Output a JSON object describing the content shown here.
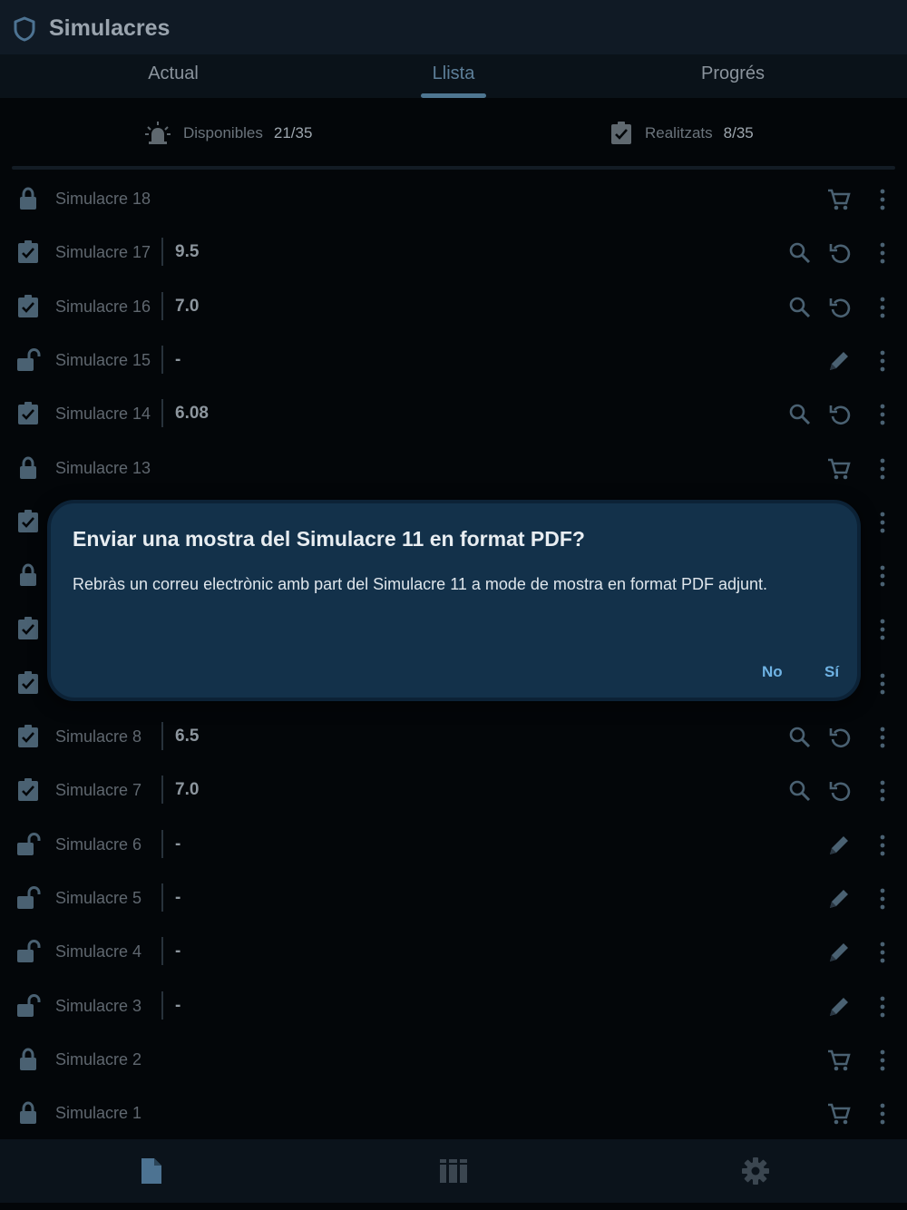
{
  "app": {
    "title": "Simulacres",
    "icon": "shield-icon"
  },
  "tabs": [
    {
      "label": "Actual",
      "active": false
    },
    {
      "label": "Llista",
      "active": true
    },
    {
      "label": "Progrés",
      "active": false
    }
  ],
  "stats": {
    "available": {
      "label": "Disponibles",
      "value": "21/35",
      "icon": "alarm-light-icon"
    },
    "done": {
      "label": "Realitzats",
      "value": "8/35",
      "icon": "clipboard-check-icon"
    }
  },
  "rows": [
    {
      "name": "Simulacre 18",
      "status": "locked",
      "score": null,
      "actions": [
        "cart"
      ]
    },
    {
      "name": "Simulacre 17",
      "status": "done",
      "score": "9.5",
      "actions": [
        "search",
        "retry"
      ]
    },
    {
      "name": "Simulacre 16",
      "status": "done",
      "score": "7.0",
      "actions": [
        "search",
        "retry"
      ]
    },
    {
      "name": "Simulacre 15",
      "status": "unlocked",
      "score": "-",
      "actions": [
        "edit"
      ]
    },
    {
      "name": "Simulacre 14",
      "status": "done",
      "score": "6.08",
      "actions": [
        "search",
        "retry"
      ]
    },
    {
      "name": "Simulacre 13",
      "status": "locked",
      "score": null,
      "actions": [
        "cart"
      ]
    },
    {
      "name": "",
      "status": "done",
      "score": null,
      "actions": []
    },
    {
      "name": "",
      "status": "locked",
      "score": null,
      "actions": []
    },
    {
      "name": "",
      "status": "done",
      "score": null,
      "actions": []
    },
    {
      "name": "",
      "status": "done",
      "score": null,
      "actions": []
    },
    {
      "name": "Simulacre 8",
      "status": "done",
      "score": "6.5",
      "actions": [
        "search",
        "retry"
      ]
    },
    {
      "name": "Simulacre 7",
      "status": "done",
      "score": "7.0",
      "actions": [
        "search",
        "retry"
      ]
    },
    {
      "name": "Simulacre 6",
      "status": "unlocked",
      "score": "-",
      "actions": [
        "edit"
      ]
    },
    {
      "name": "Simulacre 5",
      "status": "unlocked",
      "score": "-",
      "actions": [
        "edit"
      ]
    },
    {
      "name": "Simulacre 4",
      "status": "unlocked",
      "score": "-",
      "actions": [
        "edit"
      ]
    },
    {
      "name": "Simulacre 3",
      "status": "unlocked",
      "score": "-",
      "actions": [
        "edit"
      ]
    },
    {
      "name": "Simulacre 2",
      "status": "locked",
      "score": null,
      "actions": [
        "cart"
      ]
    },
    {
      "name": "Simulacre 1",
      "status": "locked",
      "score": null,
      "actions": [
        "cart"
      ]
    }
  ],
  "dialog": {
    "title": "Enviar una mostra del Simulacre 11 en format PDF?",
    "body": "Rebràs un correu electrònic amb part del Simulacre 11 a mode de mostra en format PDF adjunt.",
    "no_label": "No",
    "yes_label": "Sí"
  },
  "bottom_nav": [
    {
      "icon": "document-icon"
    },
    {
      "icon": "library-icon"
    },
    {
      "icon": "settings-icon"
    }
  ],
  "colors": {
    "background": "#030609",
    "appbar": "#101a25",
    "dialog": "#13314a",
    "accent": "#6fb3e4",
    "icon_dim": "#4a6172"
  }
}
